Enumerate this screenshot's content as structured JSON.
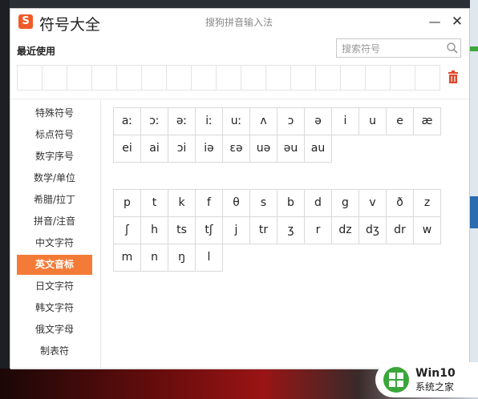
{
  "app": {
    "title": "符号大全",
    "logo_char": "S",
    "window_title": "搜狗拼音输入法",
    "minimize_icon": "—",
    "close_icon": "✕"
  },
  "recent": {
    "label": "最近使用",
    "slot_count": 17
  },
  "search": {
    "placeholder": "搜索符号",
    "value": ""
  },
  "sidebar": {
    "items": [
      {
        "label": "特殊符号"
      },
      {
        "label": "标点符号"
      },
      {
        "label": "数字序号"
      },
      {
        "label": "数学/单位"
      },
      {
        "label": "希腊/拉丁"
      },
      {
        "label": "拼音/注音"
      },
      {
        "label": "中文字符"
      },
      {
        "label": "英文音标"
      },
      {
        "label": "日文字符"
      },
      {
        "label": "韩文字符"
      },
      {
        "label": "俄文字母"
      },
      {
        "label": "制表符"
      }
    ],
    "active_index": 7
  },
  "vowels": [
    "aː",
    "ɔː",
    "əː",
    "iː",
    "uː",
    "ʌ",
    "ɔ",
    "ə",
    "i",
    "u",
    "e",
    "æ",
    "ei",
    "ai",
    "ɔi",
    "iə",
    "ɛə",
    "uə",
    "əu",
    "au"
  ],
  "consonants": [
    "p",
    "t",
    "k",
    "f",
    "θ",
    "s",
    "b",
    "d",
    "g",
    "v",
    "ð",
    "z",
    "ʃ",
    "h",
    "ts",
    "tʃ",
    "j",
    "tr",
    "ʒ",
    "r",
    "dz",
    "dʒ",
    "dr",
    "w",
    "m",
    "n",
    "ŋ",
    "l"
  ],
  "watermark": {
    "line1": "Win10",
    "line2": "系统之家"
  },
  "colors": {
    "accent": "#f47b37",
    "logo": "#f05a28",
    "trash": "#e0452a"
  }
}
